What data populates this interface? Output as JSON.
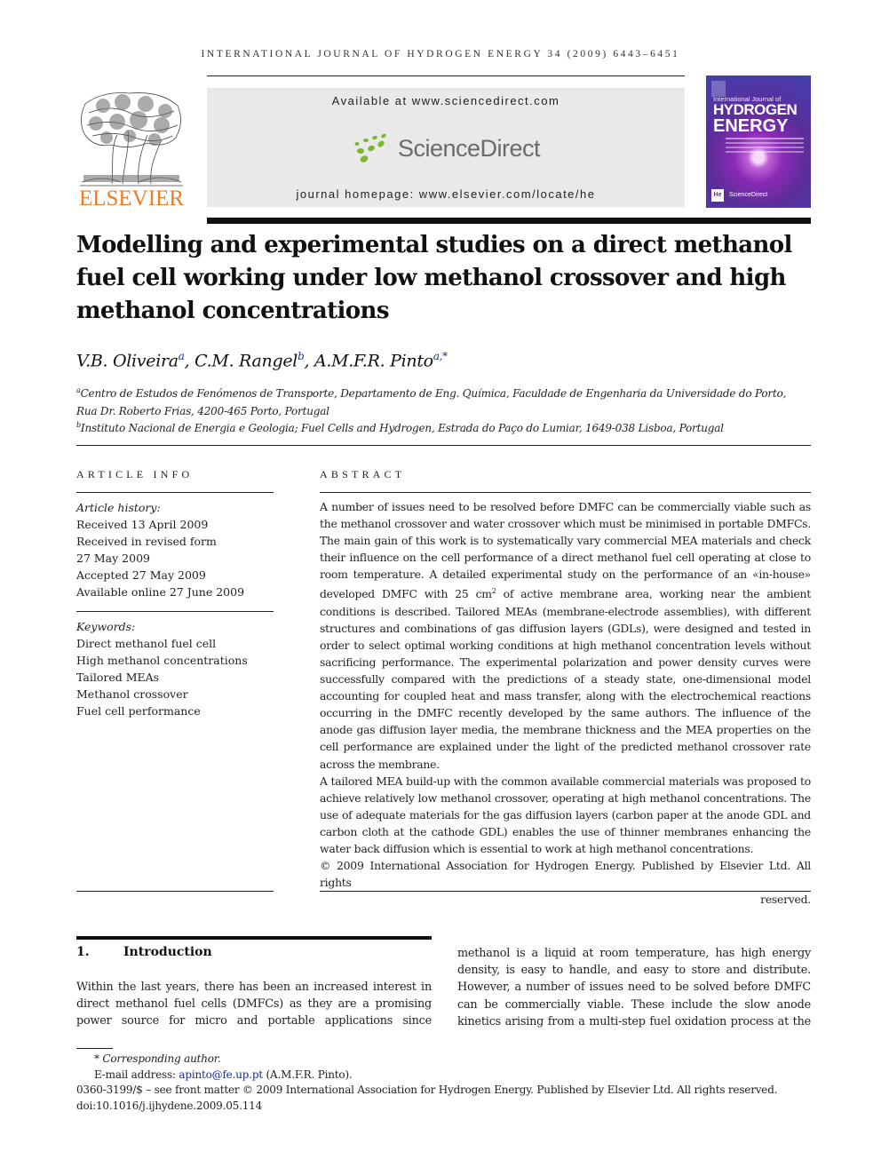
{
  "running_head": "INTERNATIONAL JOURNAL OF HYDROGEN ENERGY 34 (2009) 6443–6451",
  "masthead": {
    "publisher_logo": "ELSEVIER",
    "available_at": "Available at www.sciencedirect.com",
    "sciencedirect_label": "ScienceDirect",
    "homepage": "journal homepage: www.elsevier.com/locate/he",
    "cover": {
      "line1": "International Journal of",
      "line2": "HYDROGEN",
      "line3": "ENERGY",
      "badge": "He",
      "sd_label": "ScienceDirect"
    },
    "colors": {
      "elsevier_orange": "#f07c22",
      "sciencedirect_green": "#7cb82f",
      "banner_gray": "#e9e9e9",
      "link_blue": "#1a2d8a"
    }
  },
  "article": {
    "title": "Modelling and experimental studies on a direct methanol fuel cell working under low methanol crossover and high methanol concentrations",
    "authors": [
      {
        "name": "V.B. Oliveira",
        "sup": "a"
      },
      {
        "name": "C.M. Rangel",
        "sup": "b"
      },
      {
        "name": "A.M.F.R. Pinto",
        "sup": "a,*"
      }
    ],
    "affiliations": [
      {
        "sup": "a",
        "line1": "Centro de Estudos de Fenómenos de Transporte, Departamento de Eng. Química, Faculdade de Engenharia da Universidade do Porto,",
        "line2": "Rua Dr. Roberto Frias, 4200-465 Porto, Portugal"
      },
      {
        "sup": "b",
        "line1": "Instituto Nacional de Energia e Geologia; Fuel Cells and Hydrogen, Estrada do Paço do Lumiar, 1649-038 Lisboa, Portugal"
      }
    ]
  },
  "article_info": {
    "heading": "ARTICLE INFO",
    "history_label": "Article history:",
    "history": [
      "Received 13 April 2009",
      "Received in revised form",
      "27 May 2009",
      "Accepted 27 May 2009",
      "Available online 27 June 2009"
    ],
    "keywords_label": "Keywords:",
    "keywords": [
      "Direct methanol fuel cell",
      "High methanol concentrations",
      "Tailored MEAs",
      "Methanol crossover",
      "Fuel cell performance"
    ]
  },
  "abstract": {
    "heading": "ABSTRACT",
    "p1_a": "A number of issues need to be resolved before DMFC can be commercially viable such as the methanol crossover and water crossover which must be minimised in portable DMFCs. The main gain of this work is to systematically vary commercial MEA materials and check their influence on the cell performance of a direct methanol fuel cell operating at close to room temperature. A detailed experimental study on the performance of an «in-house» developed DMFC with 25 cm",
    "p1_sup": "2",
    "p1_b": " of active membrane area, working near the ambient conditions is described. Tailored MEAs (membrane-electrode assemblies), with different structures and combinations of gas diffusion layers (GDLs), were designed and tested in order to select optimal working conditions at high methanol concentration levels without sacrificing performance. The experimental polarization and power density curves were successfully compared with the predictions of a steady state, one-dimensional model accounting for coupled heat and mass transfer, along with the electrochemical reactions occurring in the DMFC recently developed by the same authors. The influence of the anode gas diffusion layer media, the membrane thickness and the MEA properties on the cell performance are explained under the light of the predicted methanol crossover rate across the membrane.",
    "p2": "A tailored MEA build-up with the common available commercial materials was proposed to achieve relatively low methanol crossover, operating at high methanol concentrations. The use of adequate materials for the gas diffusion layers (carbon paper at the anode GDL and carbon cloth at the cathode GDL) enables the use of thinner membranes enhancing the water back diffusion which is essential to work at high methanol concentrations.",
    "copyright_a": "© 2009 International Association for Hydrogen Energy. Published by Elsevier Ltd. All rights",
    "copyright_b": "reserved."
  },
  "introduction": {
    "number": "1.",
    "heading": "Introduction",
    "left_text": "Within the last years, there has been an increased interest in direct methanol fuel cells (DMFCs) as they are a promising power source for micro and portable applications since",
    "right_text": "methanol is a liquid at room temperature, has high energy density, is easy to handle, and easy to store and distribute. However, a number of issues need to be solved before DMFC can be commercially viable. These include the slow anode kinetics arising from a multi-step fuel oxidation process at the"
  },
  "footnotes": {
    "corresponding": "* Corresponding author.",
    "email_label": "E-mail address: ",
    "email": "apinto@fe.up.pt",
    "email_suffix": " (A.M.F.R. Pinto).",
    "front_matter": "0360-3199/$ – see front matter © 2009 International Association for Hydrogen Energy. Published by Elsevier Ltd. All rights reserved.",
    "doi": "doi:10.1016/j.ijhydene.2009.05.114"
  }
}
